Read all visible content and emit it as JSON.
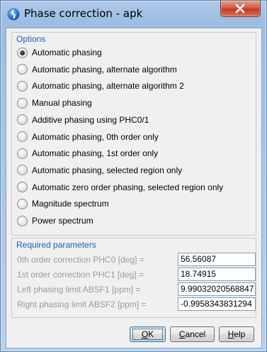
{
  "window": {
    "title": "Phase correction - apk"
  },
  "options": {
    "title": "Options",
    "items": [
      {
        "label": "Automatic phasing",
        "checked": true
      },
      {
        "label": "Automatic phasing, alternate algorithm",
        "checked": false
      },
      {
        "label": "Automatic phasing, alternate algorithm 2",
        "checked": false
      },
      {
        "label": "Manual phasing",
        "checked": false
      },
      {
        "label": "Additive phasing using PHC0/1",
        "checked": false
      },
      {
        "label": "Automatic phasing, 0th order only",
        "checked": false
      },
      {
        "label": "Automatic phasing, 1st order only",
        "checked": false
      },
      {
        "label": "Automatic phasing, selected region only",
        "checked": false
      },
      {
        "label": "Automatic zero order phasing, selected region only",
        "checked": false
      },
      {
        "label": "Magnitude spectrum",
        "checked": false
      },
      {
        "label": "Power spectrum",
        "checked": false
      }
    ]
  },
  "params": {
    "title": "Required parameters",
    "fields": [
      {
        "label": "0th order correction PHC0 [deg] =",
        "value": "56.56087"
      },
      {
        "label": "1st order correction PHC1 [deg] =",
        "value": "18.74915"
      },
      {
        "label": "Left phasing limit ABSF1 [ppm] =",
        "value": "9.99032020568847"
      },
      {
        "label": "Right phasing limit ABSF2 [ppm] =",
        "value": "-0.9958343831294"
      }
    ]
  },
  "buttons": {
    "ok": {
      "prefix": "",
      "mnemonic": "O",
      "rest": "K"
    },
    "cancel": {
      "prefix": "",
      "mnemonic": "C",
      "rest": "ancel"
    },
    "help": {
      "prefix": "",
      "mnemonic": "H",
      "rest": "elp"
    }
  },
  "colors": {
    "group_title": "#1a5fb4",
    "disabled_label": "#9a9a9a",
    "close_button": "#c23b22"
  },
  "icons": {
    "app": "bruker-topspin-icon",
    "close": "close-x-icon"
  }
}
